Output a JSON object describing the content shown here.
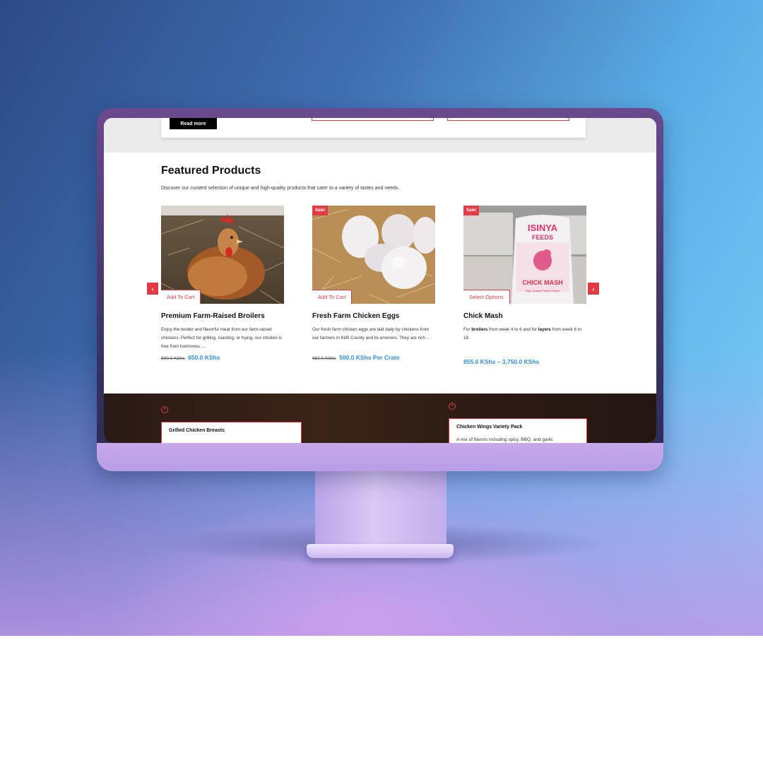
{
  "top": {
    "read_more": "Read more"
  },
  "section": {
    "title": "Featured Products",
    "description": "Discover our curated selection of unique and high-quality products that cater to a variety of tastes and needs."
  },
  "products": [
    {
      "name": "Premium Farm-Raised Broilers",
      "description": "Enjoy the tender and flavorful meat from our farm-raised chickens. Perfect for grilling, roasting, or frying, our chicken is free from hormones …",
      "old_price": "800.0 KShs",
      "new_price": "650.0 KShs",
      "button": "Add To Cart"
    },
    {
      "sale": "Sale!",
      "name": "Fresh Farm Chicken Eggs",
      "description": "Our fresh farm chicken eggs are laid daily by chickens from our farmers in Kilifi County and its environs. They are rich …",
      "old_price": "650.0 KShs",
      "new_price": "500.0 KShs Per Crate",
      "button": "Add To Cart"
    },
    {
      "sale": "Sale!",
      "name": "Chick Mash",
      "desc_pre": "For ",
      "desc_b1": "broilers",
      "desc_mid": " from week 4 to 6 and for ",
      "desc_b2": "layers",
      "desc_post": " from week 6 to 18.",
      "price_range": "855.0 KShs – 3,750.0 KShs",
      "button": "Select Options",
      "bag_brand": "ISINYA",
      "bag_line": "FEEDS",
      "bag_product": "CHICK MASH",
      "bag_sub": "High Quality Poultry Feeds"
    }
  ],
  "carousel": {
    "prev_icon": "‹",
    "next_icon": "›"
  },
  "promos": [
    {
      "title": "Grilled Chicken Breasts",
      "close_icon": "×"
    },
    {
      "title": "Chicken Wings Variety Pack",
      "description": "A mix of flavors including spicy, BBQ, and garlic",
      "close_icon": "×"
    }
  ],
  "colors": {
    "accent": "#e23b44",
    "price_blue": "#2f8fe0"
  }
}
